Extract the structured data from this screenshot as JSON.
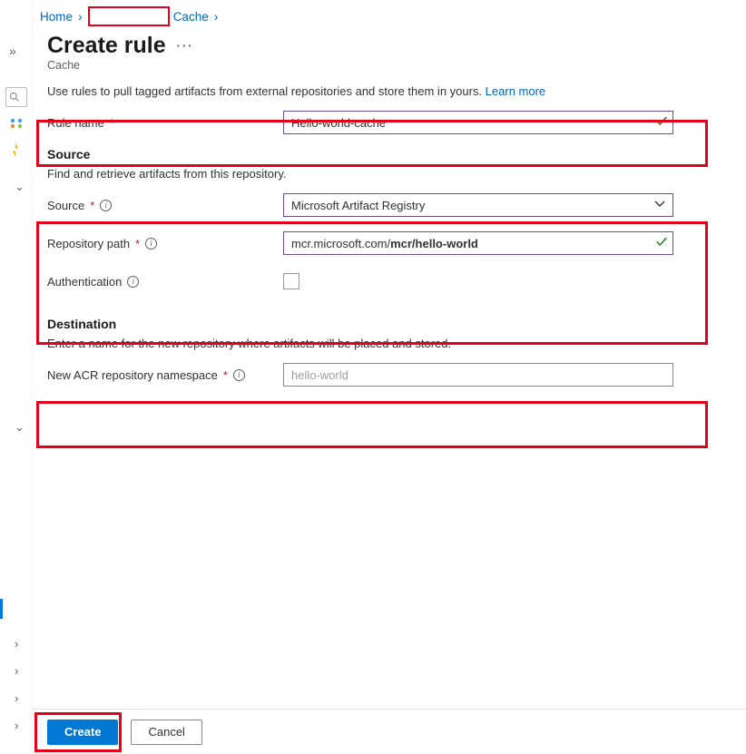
{
  "breadcrumbs": {
    "home": "Home",
    "cache": "Cache"
  },
  "header": {
    "title": "Create rule",
    "subtitle": "Cache"
  },
  "intro": {
    "text": "Use rules to pull tagged artifacts from external repositories and store them in yours. ",
    "learn_more": "Learn more"
  },
  "ruleName": {
    "label": "Rule name",
    "value": "Hello-world-cache"
  },
  "sourceSection": {
    "heading": "Source",
    "desc": "Find and retrieve artifacts from this repository."
  },
  "source": {
    "label": "Source",
    "value": "Microsoft Artifact Registry"
  },
  "repoPath": {
    "label": "Repository path",
    "prefix": "mcr.microsoft.com/",
    "value": "mcr/hello-world"
  },
  "auth": {
    "label": "Authentication"
  },
  "destSection": {
    "heading": "Destination",
    "desc": "Enter a name for the new repository where artifacts will be placed and stored."
  },
  "dest": {
    "label": "New ACR repository namespace",
    "placeholder": "hello-world",
    "value": ""
  },
  "footer": {
    "create": "Create",
    "cancel": "Cancel"
  }
}
